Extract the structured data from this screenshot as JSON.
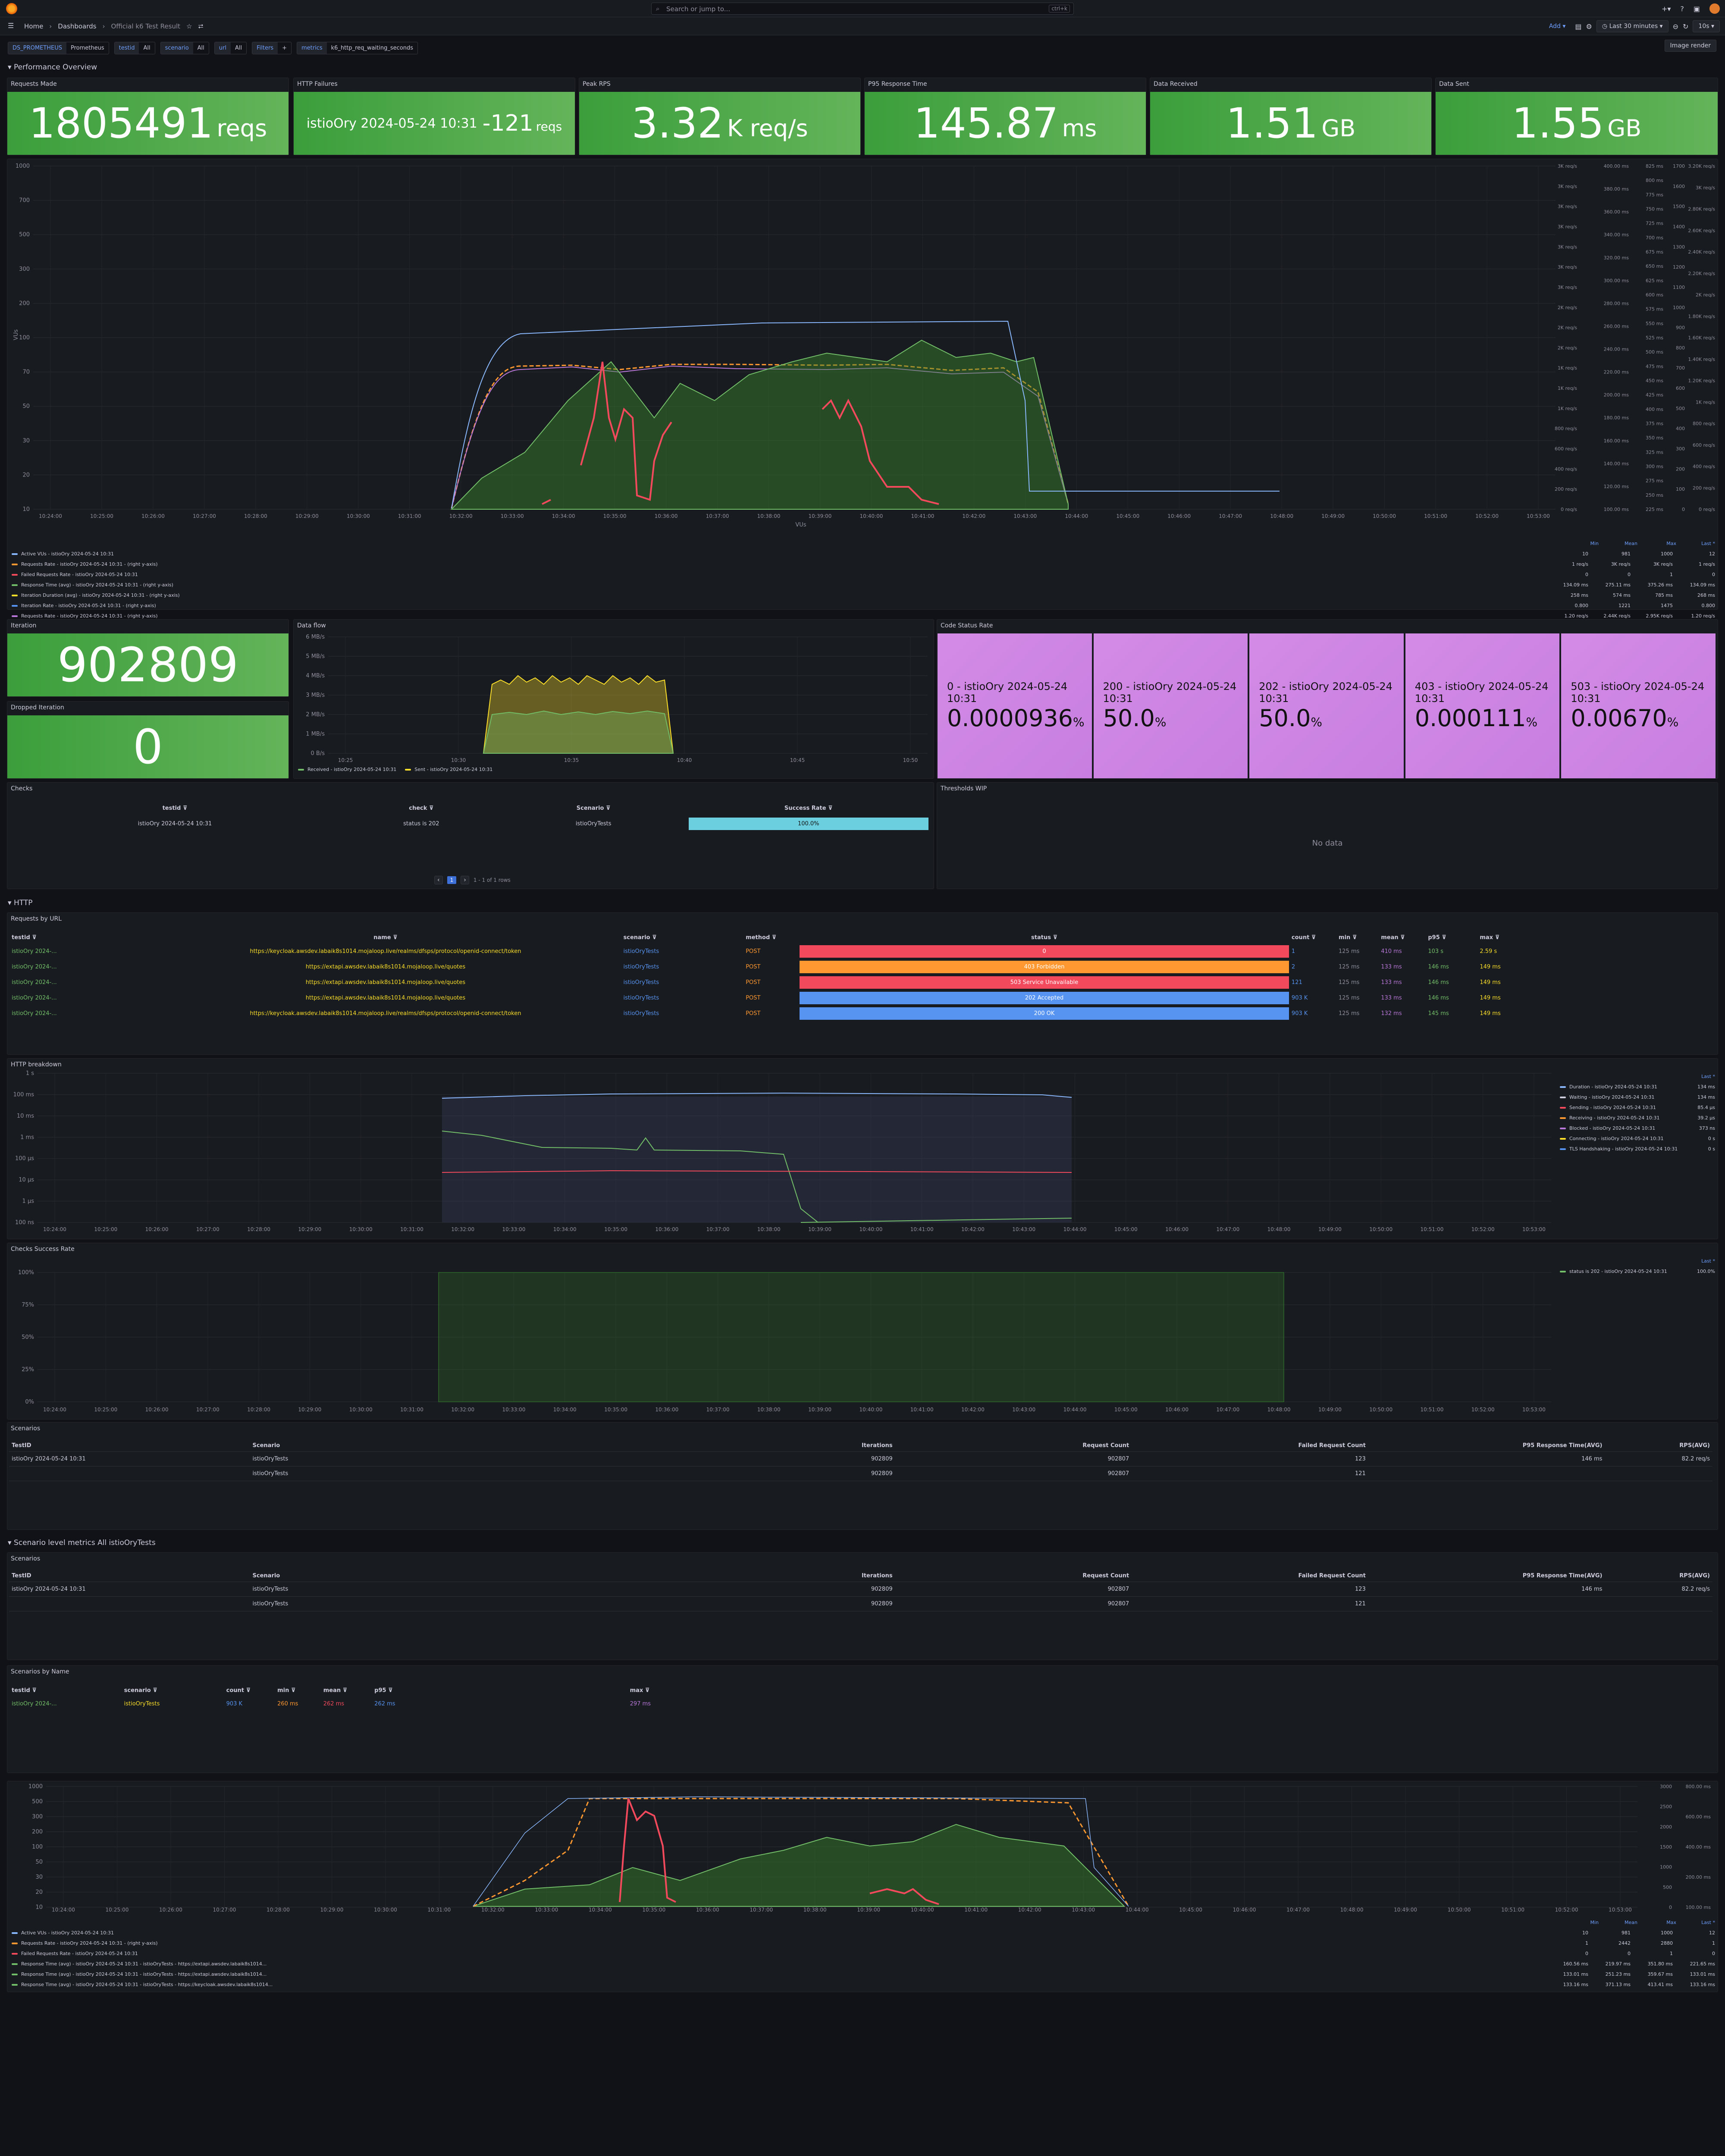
{
  "topbar": {
    "search_placeholder": "Search or jump to...",
    "search_kbd": "ctrl+k"
  },
  "nav": {
    "home": "Home",
    "dashboards": "Dashboards",
    "title": "Official k6 Test Result",
    "add": "Add",
    "time_range": "Last 30 minutes",
    "refresh": "10s"
  },
  "variables": [
    {
      "k": "DS_PROMETHEUS",
      "v": "Prometheus"
    },
    {
      "k": "testid",
      "v": "All"
    },
    {
      "k": "scenario",
      "v": "All"
    },
    {
      "k": "url",
      "v": "All"
    },
    {
      "k": "Filters",
      "v": "+"
    },
    {
      "k": "metrics",
      "v": "k6_http_req_waiting_seconds"
    }
  ],
  "image_render": "Image render",
  "rows": {
    "performance": "Performance Overview",
    "http": "HTTP",
    "scenario_level": "Scenario level metrics All istioOryTests"
  },
  "stats": {
    "requests_made": {
      "title": "Requests Made",
      "value": "1805491",
      "unit": "reqs"
    },
    "http_failures": {
      "title": "HTTP Failures",
      "label": "istioOry 2024-05-24 10:31",
      "value": "121",
      "unit": "reqs"
    },
    "peak_rps": {
      "title": "Peak RPS",
      "value": "3.32",
      "unit": "K req/s"
    },
    "p95": {
      "title": "P95 Response Time",
      "value": "145.87",
      "unit": "ms"
    },
    "data_received": {
      "title": "Data Received",
      "value": "1.51",
      "unit": "GB"
    },
    "data_sent": {
      "title": "Data Sent",
      "value": "1.55",
      "unit": "GB"
    }
  },
  "main_chart": {
    "ylabel": "VUs",
    "xlabel": "VUs",
    "y_ticks": [
      "1000",
      "700",
      "500",
      "300",
      "200",
      "100",
      "70",
      "50",
      "30",
      "20",
      "10"
    ],
    "x_ticks": [
      "10:24:00",
      "10:25:00",
      "10:26:00",
      "10:27:00",
      "10:28:00",
      "10:29:00",
      "10:30:00",
      "10:31:00",
      "10:32:00",
      "10:33:00",
      "10:34:00",
      "10:35:00",
      "10:36:00",
      "10:37:00",
      "10:38:00",
      "10:39:00",
      "10:40:00",
      "10:41:00",
      "10:42:00",
      "10:43:00",
      "10:44:00",
      "10:45:00",
      "10:46:00",
      "10:47:00",
      "10:48:00",
      "10:49:00",
      "10:50:00",
      "10:51:00",
      "10:52:00",
      "10:53:00"
    ],
    "right1": [
      "3K req/s",
      "3K req/s",
      "3K req/s",
      "3K req/s",
      "3K req/s",
      "3K req/s",
      "3K req/s",
      "2K req/s",
      "2K req/s",
      "2K req/s",
      "1K req/s",
      "1K req/s",
      "1K req/s",
      "800 req/s",
      "600 req/s",
      "400 req/s",
      "200 req/s",
      "0 req/s"
    ],
    "right2": [
      "400.00 ms",
      "380.00 ms",
      "360.00 ms",
      "340.00 ms",
      "320.00 ms",
      "300.00 ms",
      "280.00 ms",
      "260.00 ms",
      "240.00 ms",
      "220.00 ms",
      "200.00 ms",
      "180.00 ms",
      "160.00 ms",
      "140.00 ms",
      "120.00 ms",
      "100.00 ms"
    ],
    "right3": [
      "825 ms",
      "800 ms",
      "775 ms",
      "750 ms",
      "725 ms",
      "700 ms",
      "675 ms",
      "650 ms",
      "625 ms",
      "600 ms",
      "575 ms",
      "550 ms",
      "525 ms",
      "500 ms",
      "475 ms",
      "450 ms",
      "425 ms",
      "400 ms",
      "375 ms",
      "350 ms",
      "325 ms",
      "300 ms",
      "275 ms",
      "250 ms",
      "225 ms"
    ],
    "right4": [
      "1700",
      "1600",
      "1500",
      "1400",
      "1300",
      "1200",
      "1100",
      "1000",
      "900",
      "800",
      "700",
      "600",
      "500",
      "400",
      "300",
      "200",
      "100",
      "0"
    ],
    "right5": [
      "3.20K req/s",
      "3K req/s",
      "2.80K req/s",
      "2.60K req/s",
      "2.40K req/s",
      "2.20K req/s",
      "2K req/s",
      "1.80K req/s",
      "1.60K req/s",
      "1.40K req/s",
      "1.20K req/s",
      "1K req/s",
      "800 req/s",
      "600 req/s",
      "400 req/s",
      "200 req/s",
      "0 req/s"
    ],
    "legend_headers": [
      "Min",
      "Mean",
      "Max",
      "Last *"
    ],
    "legend": [
      {
        "name": "Active VUs - istioOry 2024-05-24 10:31",
        "suffix": "",
        "color": "#8ab8ff",
        "vals": [
          "10",
          "981",
          "1000",
          "12"
        ]
      },
      {
        "name": "Requests Rate - istioOry 2024-05-24 10:31",
        "suffix": "(right y-axis)",
        "color": "#ff9830",
        "vals": [
          "1 req/s",
          "3K req/s",
          "3K req/s",
          "1 req/s"
        ]
      },
      {
        "name": "Failed Requests Rate - istioOry 2024-05-24 10:31",
        "suffix": "",
        "color": "#f2495c",
        "vals": [
          "0",
          "0",
          "1",
          "0"
        ]
      },
      {
        "name": "Response Time (avg) - istioOry 2024-05-24 10:31",
        "suffix": "(right y-axis)",
        "color": "#73bf69",
        "vals": [
          "134.09 ms",
          "275.11 ms",
          "375.26 ms",
          "134.09 ms"
        ]
      },
      {
        "name": "Iteration Duration (avg) - istioOry 2024-05-24 10:31",
        "suffix": "(right y-axis)",
        "color": "#fade2a",
        "vals": [
          "258 ms",
          "574 ms",
          "785 ms",
          "268 ms"
        ]
      },
      {
        "name": "Iteration Rate - istioOry 2024-05-24 10:31",
        "suffix": "(right y-axis)",
        "color": "#5794f2",
        "vals": [
          "0.800",
          "1221",
          "1475",
          "0.800"
        ]
      },
      {
        "name": "Requests Rate - istioOry 2024-05-24 10:31",
        "suffix": "(right y-axis)",
        "color": "#b877d9",
        "vals": [
          "1.20 req/s",
          "2.44K req/s",
          "2.95K req/s",
          "1.20 req/s"
        ]
      }
    ]
  },
  "iteration": {
    "title": "Iteration",
    "value": "902809"
  },
  "dropped": {
    "title": "Dropped Iteration",
    "value": "0"
  },
  "dataflow": {
    "title": "Data flow",
    "y_ticks": [
      "6 MB/s",
      "5 MB/s",
      "4 MB/s",
      "3 MB/s",
      "2 MB/s",
      "1 MB/s",
      "0 B/s"
    ],
    "x_ticks": [
      "10:25",
      "10:30",
      "10:35",
      "10:40",
      "10:45",
      "10:50"
    ],
    "legend": [
      {
        "name": "Received - istioOry 2024-05-24 10:31",
        "color": "#73bf69"
      },
      {
        "name": "Sent - istioOry 2024-05-24 10:31",
        "color": "#fade2a"
      }
    ]
  },
  "code_status": {
    "title": "Code Status Rate",
    "items": [
      {
        "label": "0 - istioOry 2024-05-24 10:31",
        "value": "0.0000936",
        "unit": "%"
      },
      {
        "label": "200 - istioOry 2024-05-24 10:31",
        "value": "50.0",
        "unit": "%"
      },
      {
        "label": "202 - istioOry 2024-05-24 10:31",
        "value": "50.0",
        "unit": "%"
      },
      {
        "label": "403 - istioOry 2024-05-24 10:31",
        "value": "0.000111",
        "unit": "%"
      },
      {
        "label": "503 - istioOry 2024-05-24 10:31",
        "value": "0.00670",
        "unit": "%"
      }
    ]
  },
  "checks": {
    "title": "Checks",
    "headers": [
      "testid",
      "check",
      "Scenario",
      "Success Rate"
    ],
    "row": [
      "istioOry 2024-05-24 10:31",
      "status is 202",
      "istioOryTests",
      "100.0%"
    ],
    "pager": "1 - 1 of 1 rows",
    "page": "1"
  },
  "thresholds": {
    "title": "Thresholds WIP",
    "empty": "No data"
  },
  "requests_by_url": {
    "title": "Requests by URL",
    "headers": [
      "testid",
      "name",
      "scenario",
      "method",
      "status",
      "count",
      "min",
      "mean",
      "p95",
      "max"
    ],
    "rows": [
      {
        "testid": "istioOry 2024-...",
        "name": "https://keycloak.awsdev.labaik8s1014.mojaloop.live/realms/dfsps/protocol/openid-connect/token",
        "scenario": "istioOryTests",
        "method": "POST",
        "status": "0",
        "status_color": "#f2495c",
        "count": "1",
        "min": "125 ms",
        "mean": "410 ms",
        "p95": "103 s",
        "max": "2.59 s"
      },
      {
        "testid": "istioOry 2024-...",
        "name": "https://extapi.awsdev.labaik8s1014.mojaloop.live/quotes",
        "scenario": "istioOryTests",
        "method": "POST",
        "status": "403 Forbidden",
        "status_color": "#ff9830",
        "count": "2",
        "min": "125 ms",
        "mean": "133 ms",
        "p95": "146 ms",
        "max": "149 ms"
      },
      {
        "testid": "istioOry 2024-...",
        "name": "https://extapi.awsdev.labaik8s1014.mojaloop.live/quotes",
        "scenario": "istioOryTests",
        "method": "POST",
        "status": "503 Service Unavailable",
        "status_color": "#f2495c",
        "count": "121",
        "min": "125 ms",
        "mean": "133 ms",
        "p95": "146 ms",
        "max": "149 ms"
      },
      {
        "testid": "istioOry 2024-...",
        "name": "https://extapi.awsdev.labaik8s1014.mojaloop.live/quotes",
        "scenario": "istioOryTests",
        "method": "POST",
        "status": "202 Accepted",
        "status_color": "#5794f2",
        "count": "903 K",
        "min": "125 ms",
        "mean": "133 ms",
        "p95": "146 ms",
        "max": "149 ms"
      },
      {
        "testid": "istioOry 2024-...",
        "name": "https://keycloak.awsdev.labaik8s1014.mojaloop.live/realms/dfsps/protocol/openid-connect/token",
        "scenario": "istioOryTests",
        "method": "POST",
        "status": "200 OK",
        "status_color": "#5794f2",
        "count": "903 K",
        "min": "125 ms",
        "mean": "132 ms",
        "p95": "145 ms",
        "max": "149 ms"
      }
    ]
  },
  "http_breakdown": {
    "title": "HTTP breakdown",
    "y_ticks": [
      "1 s",
      "100 ms",
      "10 ms",
      "1 ms",
      "100 µs",
      "10 µs",
      "1 µs",
      "100 ns"
    ],
    "legend_header": "Last *",
    "legend": [
      {
        "name": "Duration - istioOry 2024-05-24 10:31",
        "color": "#8ab8ff",
        "val": "134 ms"
      },
      {
        "name": "Waiting - istioOry 2024-05-24 10:31",
        "color": "#ccccdc",
        "val": "134 ms"
      },
      {
        "name": "Sending - istioOry 2024-05-24 10:31",
        "color": "#f2495c",
        "val": "85.4 µs"
      },
      {
        "name": "Receiving - istioOry 2024-05-24 10:31",
        "color": "#ff9830",
        "val": "39.2 µs"
      },
      {
        "name": "Blocked - istioOry 2024-05-24 10:31",
        "color": "#b877d9",
        "val": "373 ns"
      },
      {
        "name": "Connecting - istioOry 2024-05-24 10:31",
        "color": "#fade2a",
        "val": "0 s"
      },
      {
        "name": "TLS Handshaking - istioOry 2024-05-24 10:31",
        "color": "#5794f2",
        "val": "0 s"
      }
    ]
  },
  "checks_success": {
    "title": "Checks Success Rate",
    "y_ticks": [
      "100%",
      "75%",
      "50%",
      "25%",
      "0%"
    ],
    "legend_header": "Last *",
    "legend": [
      {
        "name": "status is 202 - istioOry 2024-05-24 10:31",
        "color": "#73bf69",
        "val": "100.0%"
      }
    ]
  },
  "scenarios_table": {
    "title": "Scenarios",
    "headers": [
      "TestID",
      "Scenario",
      "Iterations",
      "Request Count",
      "Failed Request Count",
      "P95 Response Time(AVG)",
      "RPS(AVG)"
    ],
    "rows": [
      [
        "istioOry 2024-05-24 10:31",
        "istioOryTests",
        "902809",
        "902807",
        "123",
        "146 ms",
        "82.2 req/s"
      ],
      [
        "",
        "istioOryTests",
        "902809",
        "902807",
        "121",
        "",
        ""
      ]
    ]
  },
  "scenarios_by_name": {
    "title": "Scenarios by Name",
    "headers": [
      "testid",
      "scenario",
      "count",
      "min",
      "mean",
      "p95",
      "max"
    ],
    "row": [
      "istioOry 2024-...",
      "istioOryTests",
      "903 K",
      "260 ms",
      "262 ms",
      "262 ms",
      "297 ms"
    ]
  },
  "scen_chart": {
    "y_ticks": [
      "1000",
      "500",
      "300",
      "200",
      "100",
      "50",
      "30",
      "20",
      "10"
    ],
    "right1": [
      "3000",
      "2500",
      "2000",
      "1500",
      "1000",
      "500",
      "0"
    ],
    "right2": [
      "800.00 ms",
      "600.00 ms",
      "400.00 ms",
      "200.00 ms",
      "100.00 ms"
    ],
    "legend_headers": [
      "Min",
      "Mean",
      "Max",
      "Last *"
    ],
    "legend": [
      {
        "name": "Active VUs - istioOry 2024-05-24 10:31",
        "color": "#8ab8ff",
        "vals": [
          "10",
          "981",
          "1000",
          "12"
        ]
      },
      {
        "name": "Requests Rate - istioOry 2024-05-24 10:31 - (right y-axis)",
        "color": "#ff9830",
        "vals": [
          "1",
          "2442",
          "2880",
          "1"
        ]
      },
      {
        "name": "Failed Requests Rate - istioOry 2024-05-24 10:31",
        "color": "#f2495c",
        "vals": [
          "0",
          "0",
          "1",
          "0"
        ]
      },
      {
        "name": "Response Time (avg) - istioOry 2024-05-24 10:31 - istioOryTests - https://extapi.awsdev.labaik8s1014...",
        "color": "#73bf69",
        "vals": [
          "160.56 ms",
          "219.97 ms",
          "351.80 ms",
          "221.65 ms"
        ]
      },
      {
        "name": "Response Time (avg) - istioOry 2024-05-24 10:31 - istioOryTests - https://extapi.awsdev.labaik8s1014...",
        "color": "#73bf69",
        "vals": [
          "133.01 ms",
          "251.23 ms",
          "359.67 ms",
          "133.01 ms"
        ]
      },
      {
        "name": "Response Time (avg) - istioOry 2024-05-24 10:31 - istioOryTests - https://keycloak.awsdev.labaik8s1014...",
        "color": "#73bf69",
        "vals": [
          "133.16 ms",
          "371.13 ms",
          "413.41 ms",
          "133.16 ms"
        ]
      }
    ]
  }
}
